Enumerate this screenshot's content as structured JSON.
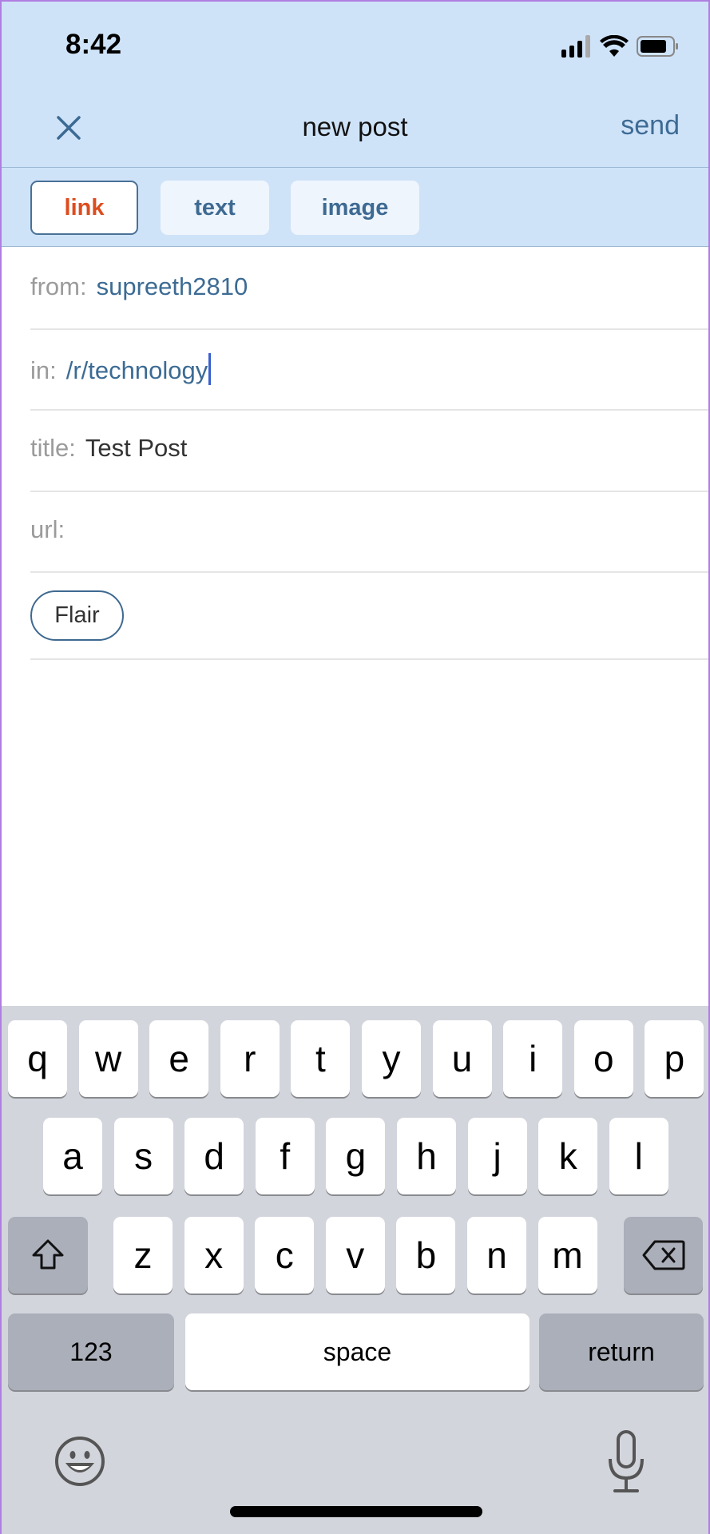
{
  "status_bar": {
    "time": "8:42",
    "icons": [
      "cellular-signal-icon",
      "wifi-icon",
      "battery-icon"
    ]
  },
  "nav": {
    "close_icon": "close-icon",
    "title": "new post",
    "send_label": "send"
  },
  "post_types": [
    {
      "label": "link",
      "selected": true
    },
    {
      "label": "text",
      "selected": false
    },
    {
      "label": "image",
      "selected": false
    }
  ],
  "form": {
    "from": {
      "label": "from:",
      "value": "supreeth2810"
    },
    "in": {
      "label": "in:",
      "value": "/r/technology"
    },
    "title": {
      "label": "title:",
      "value": "Test Post"
    },
    "url": {
      "label": "url:",
      "value": ""
    },
    "flair_label": "Flair"
  },
  "keyboard": {
    "row1": [
      "q",
      "w",
      "e",
      "r",
      "t",
      "y",
      "u",
      "i",
      "o",
      "p"
    ],
    "row2": [
      "a",
      "s",
      "d",
      "f",
      "g",
      "h",
      "j",
      "k",
      "l"
    ],
    "row3": [
      "z",
      "x",
      "c",
      "v",
      "b",
      "n",
      "m"
    ],
    "numbers_label": "123",
    "space_label": "space",
    "return_label": "return",
    "icons": [
      "shift-icon",
      "backspace-icon",
      "emoji-icon",
      "microphone-icon"
    ]
  },
  "colors": {
    "header_bg": "#cfe3f8",
    "accent_blue": "#3c6b94",
    "selected_tab_text": "#dc4d1e",
    "caret": "#3a5fcf"
  }
}
